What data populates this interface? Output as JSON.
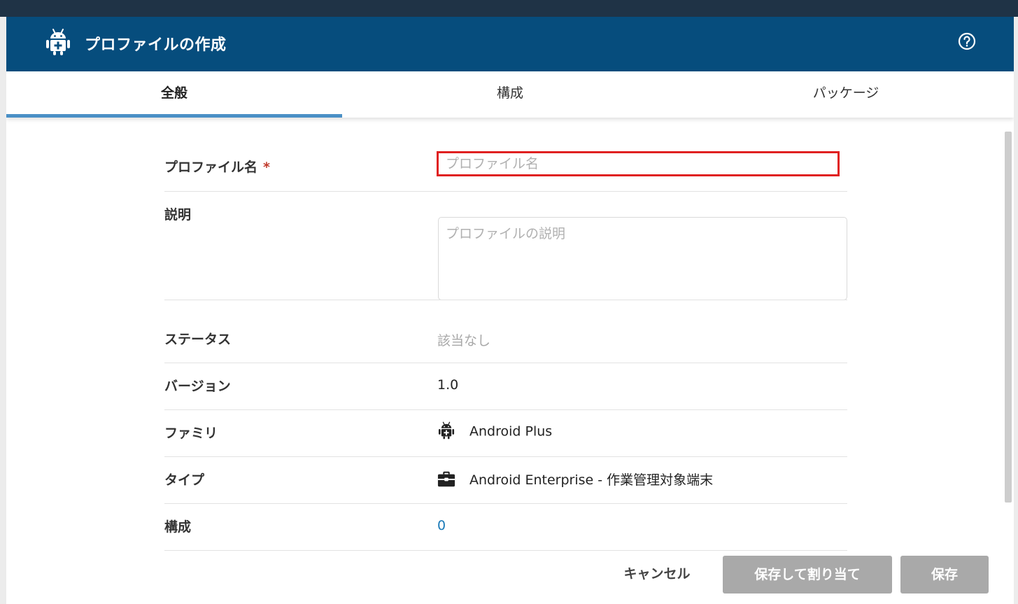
{
  "dialog": {
    "title": "プロファイルの作成",
    "header_icon": "android-plus-icon",
    "help_icon": "help-circle-icon"
  },
  "tabs": [
    {
      "label": "全般",
      "active": true
    },
    {
      "label": "構成",
      "active": false
    },
    {
      "label": "パッケージ",
      "active": false
    }
  ],
  "form": {
    "profile_name": {
      "label": "プロファイル名",
      "required_mark": "*",
      "placeholder": "プロファイル名",
      "value": ""
    },
    "description": {
      "label": "説明",
      "placeholder": "プロファイルの説明",
      "value": ""
    },
    "status": {
      "label": "ステータス",
      "value": "該当なし"
    },
    "version": {
      "label": "バージョン",
      "value": "1.0"
    },
    "family": {
      "label": "ファミリ",
      "value": "Android Plus",
      "icon": "android-plus-icon"
    },
    "type": {
      "label": "タイプ",
      "value": "Android Enterprise - 作業管理対象端末",
      "icon": "briefcase-icon"
    },
    "configurations": {
      "label": "構成",
      "value": "0"
    }
  },
  "footer": {
    "cancel_label": "キャンセル",
    "save_assign_label": "保存して割り当て",
    "save_label": "保存"
  },
  "colors": {
    "header_bg": "#064d7d",
    "tab_active_underline": "#4a90c6",
    "highlight_border": "#e02020",
    "disabled_button": "#a9a9a9",
    "link": "#1a7ab8"
  }
}
